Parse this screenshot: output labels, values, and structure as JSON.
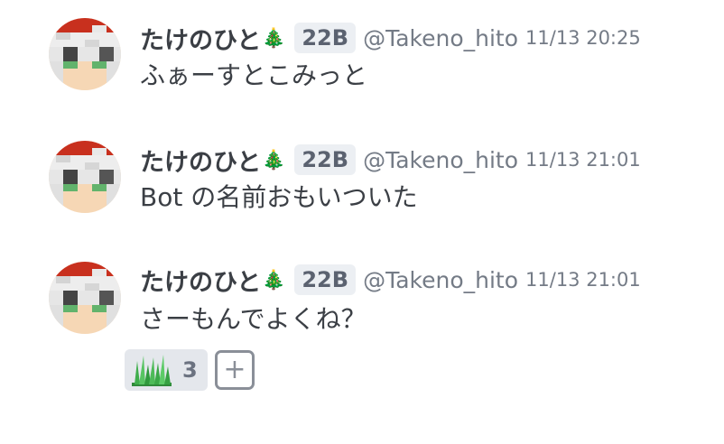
{
  "messages": [
    {
      "name": "たけのひと",
      "emoji": "🎄",
      "badge": "22B",
      "handle": "@Takeno_hito",
      "time": "11/13 20:25",
      "text": "ふぁーすとこみっと"
    },
    {
      "name": "たけのひと",
      "emoji": "🎄",
      "badge": "22B",
      "handle": "@Takeno_hito",
      "time": "11/13 21:01",
      "text": "Bot の名前おもいついた"
    },
    {
      "name": "たけのひと",
      "emoji": "🎄",
      "badge": "22B",
      "handle": "@Takeno_hito",
      "time": "11/13 21:01",
      "text": "さーもんでよくね？"
    }
  ],
  "reactions": [
    {
      "icon": "grass-stamp-icon",
      "count": "3"
    }
  ],
  "add_reaction_label": "+",
  "colors": {
    "hat_red": "#c8301e",
    "skin": "#f6d7b5",
    "eye_green": "#62b36c",
    "name": "#3b3f45",
    "meta": "#747b86",
    "badge_bg": "#eceff3"
  }
}
